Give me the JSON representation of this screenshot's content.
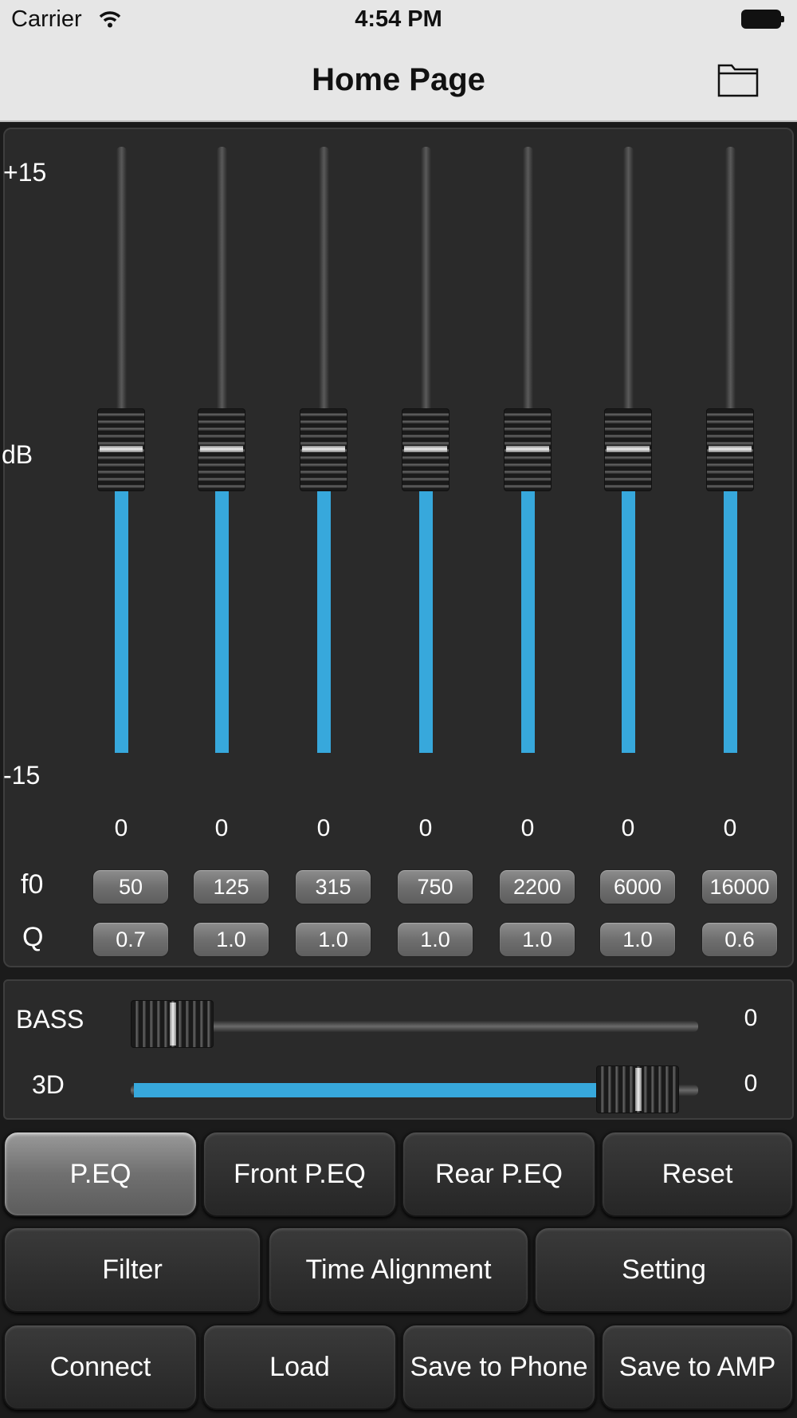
{
  "status_bar": {
    "carrier": "Carrier",
    "time": "4:54 PM"
  },
  "nav": {
    "title": "Home Page",
    "folder_icon": "folder-icon"
  },
  "eq": {
    "max_label": "+15",
    "mid_label": "dB",
    "min_label": "-15",
    "f0_label": "f0",
    "q_label": "Q",
    "bands": [
      {
        "gain": "0",
        "level": 0.0,
        "f0": "50",
        "q": "0.7"
      },
      {
        "gain": "0",
        "level": 0.0,
        "f0": "125",
        "q": "1.0"
      },
      {
        "gain": "0",
        "level": 0.0,
        "f0": "315",
        "q": "1.0"
      },
      {
        "gain": "0",
        "level": 0.0,
        "f0": "750",
        "q": "1.0"
      },
      {
        "gain": "0",
        "level": 0.0,
        "f0": "2200",
        "q": "1.0"
      },
      {
        "gain": "0",
        "level": 0.0,
        "f0": "6000",
        "q": "1.0"
      },
      {
        "gain": "0",
        "level": 0.0,
        "f0": "16000",
        "q": "0.6"
      }
    ]
  },
  "tone": {
    "bass": {
      "label": "BASS",
      "value": "0",
      "level": 0.0
    },
    "three_d": {
      "label": "3D",
      "value": "0",
      "level": 0.96
    }
  },
  "buttons": {
    "row1": [
      {
        "label": "P.EQ",
        "active": true
      },
      {
        "label": "Front P.EQ"
      },
      {
        "label": "Rear P.EQ"
      },
      {
        "label": "Reset"
      }
    ],
    "row2": [
      {
        "label": "Filter"
      },
      {
        "label": "Time Alignment"
      },
      {
        "label": "Setting"
      }
    ],
    "row3": [
      {
        "label": "Connect"
      },
      {
        "label": "Load"
      },
      {
        "label": "Save to Phone"
      },
      {
        "label": "Save to AMP"
      }
    ]
  },
  "colors": {
    "accent": "#37a8dc",
    "panel": "#2a2a2a",
    "navbar": "#e6e6e6"
  }
}
